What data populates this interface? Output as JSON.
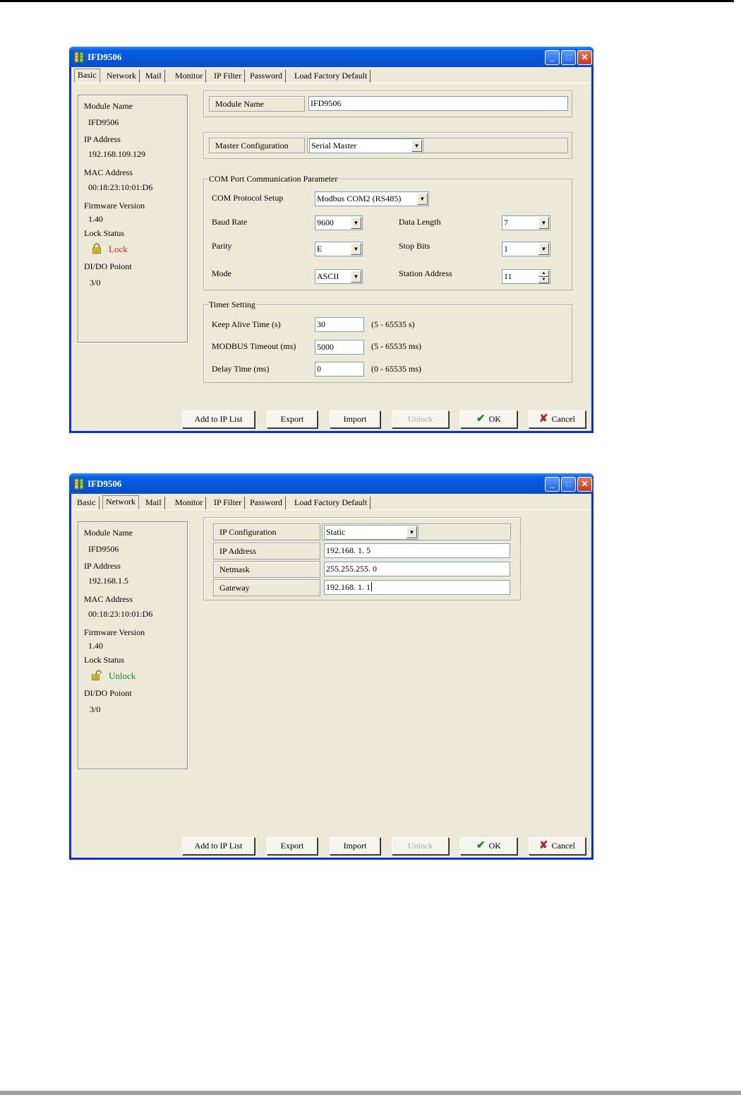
{
  "window_title": "IFD9506",
  "tabs": [
    "Basic",
    "Network",
    "Mail",
    "Monitor",
    "IP Filter",
    "Password",
    "Load Factory Default"
  ],
  "window_controls": {
    "minimize": "_",
    "maximize": "□",
    "close": "✕"
  },
  "buttons": {
    "add_to_ip_list": "Add to IP List",
    "export": "Export",
    "import": "Import",
    "unlock": "Unlock",
    "ok": "OK",
    "cancel": "Cancel"
  },
  "icons": {
    "ok": "checkmark-icon",
    "cancel": "x-mark-icon",
    "lock": "padlock-icon",
    "app": "app-icon"
  },
  "colors": {
    "title_bar": "#0a5fe3",
    "dialog_bg": "#ece9d8",
    "lock_red": "#e0201a",
    "unlock_green": "#1a8a1a"
  },
  "window_basic": {
    "active_tab": "Basic",
    "info": {
      "module_name_label": "Module Name",
      "module_name_value": "IFD9506",
      "ip_address_label": "IP Address",
      "ip_address_value": "192.168.109.129",
      "mac_address_label": "MAC Address",
      "mac_address_value": "00:18:23:10:01:D6",
      "firmware_label": "Firmware Version",
      "firmware_value": "1.40",
      "lock_status_label": "Lock Status",
      "lock_status_value": "Lock",
      "dido_label": "DI/DO Poiont",
      "dido_value": "3/0"
    },
    "module_name": {
      "label": "Module Name",
      "value": "IFD9506"
    },
    "master_config": {
      "label": "Master Configuration",
      "value": "Serial Master"
    },
    "com_port": {
      "title": "COM Port Communication Parameter",
      "protocol_label": "COM Protocol Setup",
      "protocol_value": "Modbus COM2 (RS485)",
      "baud_label": "Baud Rate",
      "baud_value": "9600",
      "data_length_label": "Data Length",
      "data_length_value": "7",
      "parity_label": "Parity",
      "parity_value": "E",
      "stop_bits_label": "Stop Bits",
      "stop_bits_value": "1",
      "mode_label": "Mode",
      "mode_value": "ASCII",
      "station_label": "Station Address",
      "station_value": "11"
    },
    "timer": {
      "title": "Timer Setting",
      "keep_alive_label": "Keep Alive Time (s)",
      "keep_alive_value": "30",
      "keep_alive_range": "(5 - 65535 s)",
      "modbus_timeout_label": "MODBUS Timeout (ms)",
      "modbus_timeout_value": "5000",
      "modbus_timeout_range": "(5 - 65535 ms)",
      "delay_label": "Delay Time (ms)",
      "delay_value": "0",
      "delay_range": "(0 - 65535 ms)"
    }
  },
  "window_network": {
    "active_tab": "Network",
    "info": {
      "module_name_label": "Module Name",
      "module_name_value": "IFD9506",
      "ip_address_label": "IP Address",
      "ip_address_value": "192.168.1.5",
      "mac_address_label": "MAC Address",
      "mac_address_value": "00:18:23:10:01:D6",
      "firmware_label": "Firmware Version",
      "firmware_value": "1.40",
      "lock_status_label": "Lock Status",
      "lock_status_value": "Unlock",
      "dido_label": "DI/DO Poiont",
      "dido_value": "3/0"
    },
    "ip_config": {
      "label": "IP Configuration",
      "value": "Static"
    },
    "ip_address": {
      "label": "IP Address",
      "value": "192.168.  1.  5"
    },
    "netmask": {
      "label": "Netmask",
      "value": "255.255.255.  0"
    },
    "gateway": {
      "label": "Gateway",
      "value": "192.168.  1.  1"
    }
  }
}
